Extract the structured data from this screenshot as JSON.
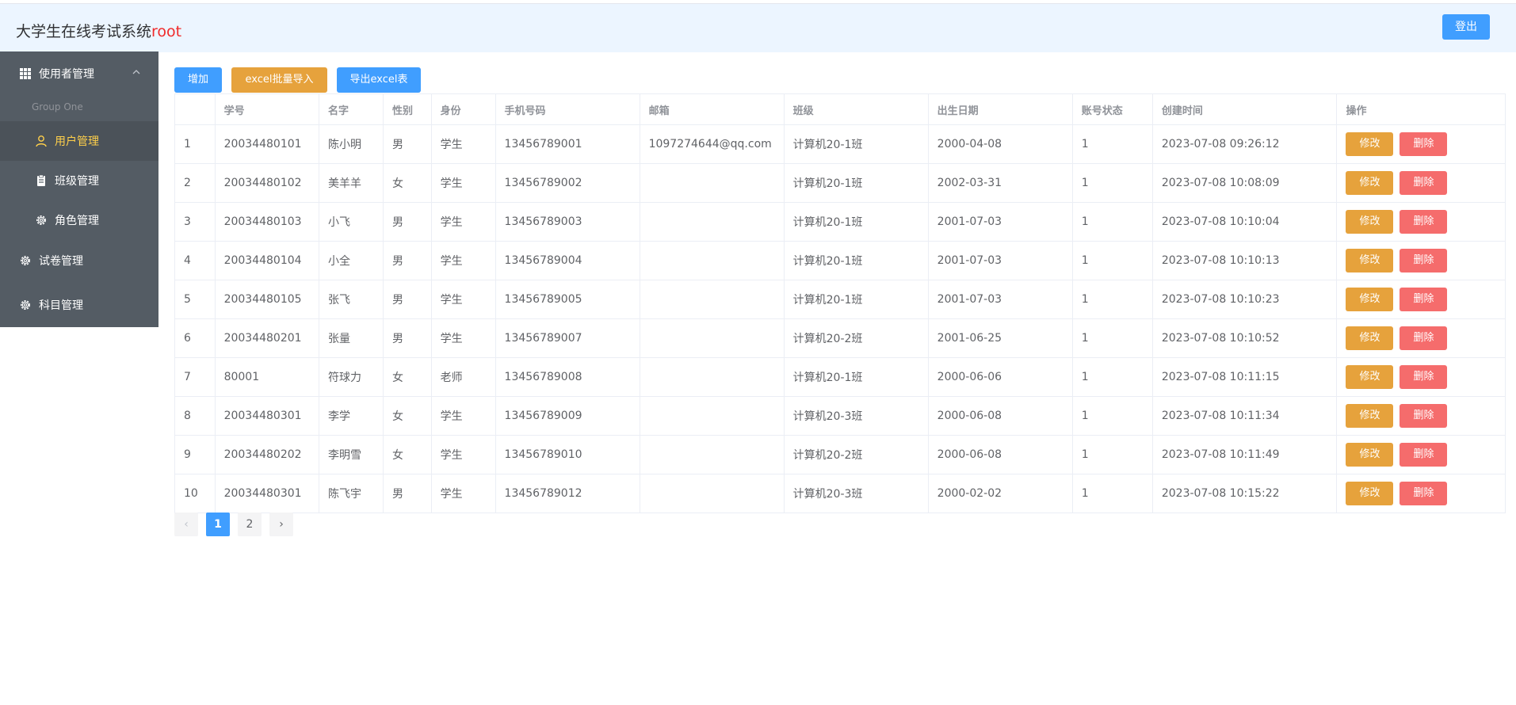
{
  "header": {
    "title": "大学生在线考试系统",
    "user": "root",
    "logout_label": "登出"
  },
  "sidebar": {
    "group_user": {
      "label": "使用者管理",
      "icon": "grid-icon",
      "expanded": true
    },
    "group_title": "Group One",
    "items": [
      {
        "label": "用户管理",
        "icon": "user-icon",
        "active": true
      },
      {
        "label": "班级管理",
        "icon": "clipboard-icon",
        "active": false
      },
      {
        "label": "角色管理",
        "icon": "gear-icon",
        "active": false
      }
    ],
    "group_exam": {
      "label": "试卷管理",
      "icon": "gear-icon"
    },
    "group_subject": {
      "label": "科目管理",
      "icon": "gear-icon"
    },
    "active_color": "#ffd04b",
    "bg_color": "#545c64"
  },
  "toolbar": {
    "add_label": "增加",
    "import_label": "excel批量导入",
    "export_label": "导出excel表"
  },
  "table": {
    "columns": [
      "",
      "学号",
      "名字",
      "性别",
      "身份",
      "手机号码",
      "邮箱",
      "班级",
      "出生日期",
      "账号状态",
      "创建时间",
      "操作"
    ],
    "rows": [
      [
        "1",
        "20034480101",
        "陈小明",
        "男",
        "学生",
        "13456789001",
        "1097274644@qq.com",
        "计算机20-1班",
        "2000-04-08",
        "1",
        "2023-07-08 09:26:12"
      ],
      [
        "2",
        "20034480102",
        "美羊羊",
        "女",
        "学生",
        "13456789002",
        "",
        "计算机20-1班",
        "2002-03-31",
        "1",
        "2023-07-08 10:08:09"
      ],
      [
        "3",
        "20034480103",
        "小飞",
        "男",
        "学生",
        "13456789003",
        "",
        "计算机20-1班",
        "2001-07-03",
        "1",
        "2023-07-08 10:10:04"
      ],
      [
        "4",
        "20034480104",
        "小全",
        "男",
        "学生",
        "13456789004",
        "",
        "计算机20-1班",
        "2001-07-03",
        "1",
        "2023-07-08 10:10:13"
      ],
      [
        "5",
        "20034480105",
        "张飞",
        "男",
        "学生",
        "13456789005",
        "",
        "计算机20-1班",
        "2001-07-03",
        "1",
        "2023-07-08 10:10:23"
      ],
      [
        "6",
        "20034480201",
        "张量",
        "男",
        "学生",
        "13456789007",
        "",
        "计算机20-2班",
        "2001-06-25",
        "1",
        "2023-07-08 10:10:52"
      ],
      [
        "7",
        "80001",
        "符球力",
        "女",
        "老师",
        "13456789008",
        "",
        "计算机20-1班",
        "2000-06-06",
        "1",
        "2023-07-08 10:11:15"
      ],
      [
        "8",
        "20034480301",
        "李学",
        "女",
        "学生",
        "13456789009",
        "",
        "计算机20-3班",
        "2000-06-08",
        "1",
        "2023-07-08 10:11:34"
      ],
      [
        "9",
        "20034480202",
        "李明雪",
        "女",
        "学生",
        "13456789010",
        "",
        "计算机20-2班",
        "2000-06-08",
        "1",
        "2023-07-08 10:11:49"
      ],
      [
        "10",
        "20034480301",
        "陈飞宇",
        "男",
        "学生",
        "13456789012",
        "",
        "计算机20-3班",
        "2000-02-02",
        "1",
        "2023-07-08 10:15:22"
      ]
    ],
    "edit_label": "修改",
    "delete_label": "删除"
  },
  "pagination": {
    "prev": "‹",
    "pages": [
      "1",
      "2"
    ],
    "current": "1",
    "next": "›"
  },
  "colors": {
    "primary": "#409eff",
    "warning": "#e6a23c",
    "danger": "#f56c6c",
    "header_bg": "#ecf5ff",
    "user_name": "#f02a2a"
  }
}
